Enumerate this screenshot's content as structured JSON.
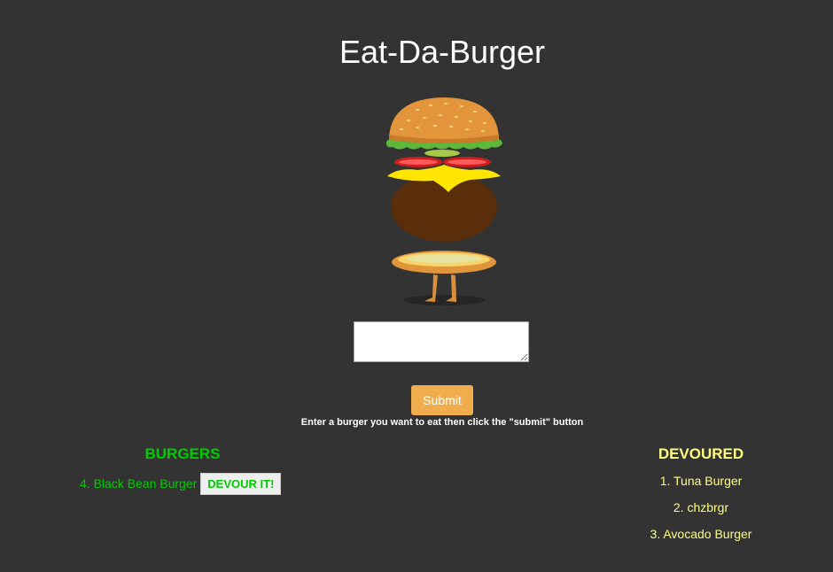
{
  "header": {
    "title": "Eat-Da-Burger",
    "logo_icon": "burger-character-logo"
  },
  "form": {
    "input_value": "",
    "submit_label": "Submit",
    "instructions": "Enter a burger you want to eat then click the \"submit\" button"
  },
  "burgers": {
    "heading": "BURGERS",
    "items": [
      {
        "label": "4. Black Bean Burger",
        "button_label": "DEVOUR IT!"
      }
    ]
  },
  "devoured": {
    "heading": "DEVOURED",
    "items": [
      {
        "label": "1. Tuna Burger"
      },
      {
        "label": "2. chzbrgr"
      },
      {
        "label": "3. Avocado Burger"
      }
    ]
  },
  "colors": {
    "background": "#333333",
    "accent_green": "#00cc00",
    "accent_yellow": "#ffff80",
    "submit_orange": "#f0ad4e"
  }
}
